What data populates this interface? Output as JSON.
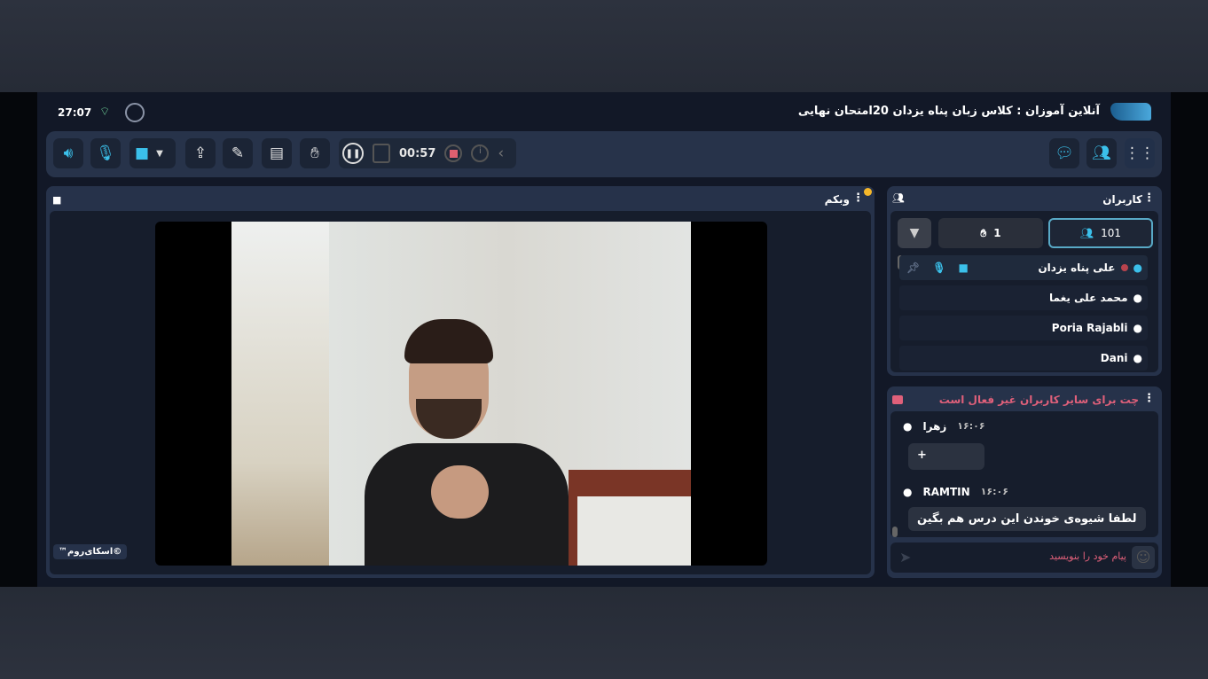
{
  "header": {
    "clock": "27:07",
    "title": "آنلاین آموزان : کلاس زبان پناه یزدان 20امتحان نهایی"
  },
  "toolbar": {
    "timer": "00:57"
  },
  "webcam": {
    "title": "وبکم",
    "watermark": "©اسکای‌روم™"
  },
  "users": {
    "title": "کاربران",
    "count": "101",
    "hands": "1",
    "list": [
      {
        "name": "علی پناه یزدان"
      },
      {
        "name": "محمد علی یغما"
      },
      {
        "name": "Poria Rajabli"
      },
      {
        "name": "Dani"
      }
    ]
  },
  "chat": {
    "title": "چت برای سایر کاربران غیر فعال است",
    "placeholder": "پیام خود را بنویسید",
    "messages": [
      {
        "sender": "زهرا",
        "time": "۱۶:۰۶",
        "text": "+"
      },
      {
        "sender": "RAMTIN",
        "time": "۱۶:۰۶",
        "text": "لطفا شیوه‌ی خوندن این درس هم بگین"
      }
    ]
  },
  "colors": {
    "accent": "#3bc0ea",
    "alert": "#e0607a"
  }
}
